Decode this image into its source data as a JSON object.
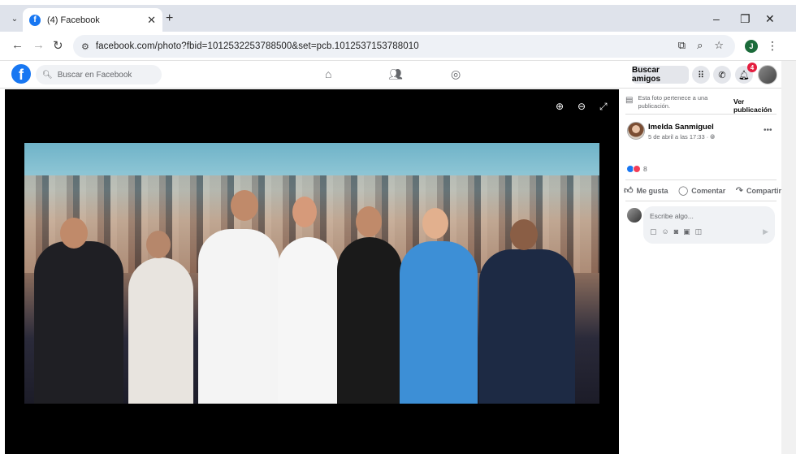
{
  "browser": {
    "tab_title": "(4) Facebook",
    "tab_favicon": "f",
    "url": "facebook.com/photo?fbid=1012532253788500&set=pcb.1012537153788010",
    "profile_initial": "J"
  },
  "facebook": {
    "logo": "f",
    "search_placeholder": "Buscar en Facebook",
    "find_friends_label": "Buscar amigos",
    "notification_count": "4"
  },
  "side_panel": {
    "belongs_text": "Esta foto pertenece a una publicación.",
    "view_post_label": "Ver publicación",
    "author_name": "Imelda Sanmiguel",
    "post_date": "5 de abril a las 17:33 · ",
    "reaction_count": "8",
    "actions": {
      "like": "Me gusta",
      "comment": "Comentar",
      "share": "Compartir"
    },
    "comment_placeholder": "Escribe algo..."
  },
  "colors": {
    "fb_blue": "#1877f2",
    "viewer_bg": "#000000",
    "notif_red": "#e41e3f"
  }
}
